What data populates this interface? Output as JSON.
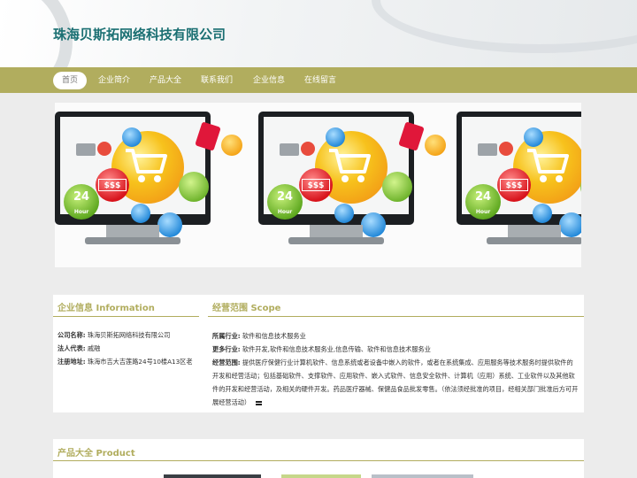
{
  "site": {
    "company_name": "珠海贝斯拓网络科技有限公司"
  },
  "nav": {
    "items": [
      {
        "label": "首页",
        "active": true
      },
      {
        "label": "企业简介"
      },
      {
        "label": "产品大全"
      },
      {
        "label": "联系我们"
      },
      {
        "label": "企业信息"
      },
      {
        "label": "在线留言"
      }
    ]
  },
  "banner": {
    "images": [
      {
        "dollar": "$$$",
        "h24": "24",
        "hour": "Hour"
      },
      {
        "dollar": "$$$",
        "h24": "24",
        "hour": "Hour"
      },
      {
        "dollar": "$$$",
        "h24": "24",
        "hour": "Hour"
      }
    ]
  },
  "company_info": {
    "title": "企业信息 Information",
    "rows": [
      {
        "label": "公司名称:",
        "value": "珠海贝斯拓网络科技有限公司"
      },
      {
        "label": "法人代表:",
        "value": "戚融"
      },
      {
        "label": "注册地址:",
        "value": "珠海市吉大吉莲路24号10楼A13区老"
      }
    ]
  },
  "business_scope": {
    "title": "经营范围 Scope",
    "rows": [
      {
        "label": "所属行业:",
        "value": "软件和信息技术服务业"
      },
      {
        "label": "更多行业:",
        "value": "软件开发,软件和信息技术服务业,信息传输、软件和信息技术服务业"
      },
      {
        "label": "经营范围:",
        "value": "提供医疗保健行业计算机软件、信息系统或者设备中嵌入的软件，或者在系统集成、应用服务等技术服务时提供软件的开发和经营活动；包括基础软件、支撑软件、应用软件、嵌入式软件、信息安全软件、计算机（应用）系统、工业软件以及其他软件的开发和经营活动，及相关的硬件开发。药品医疗器械、保健品食品批发零售。（依法须经批准的项目，经相关部门批准后方可开展经营活动）"
      }
    ]
  },
  "products": {
    "title": "产品大全 Product"
  },
  "colors": {
    "accent": "#b1ad5e",
    "title": "#1a6f72"
  }
}
